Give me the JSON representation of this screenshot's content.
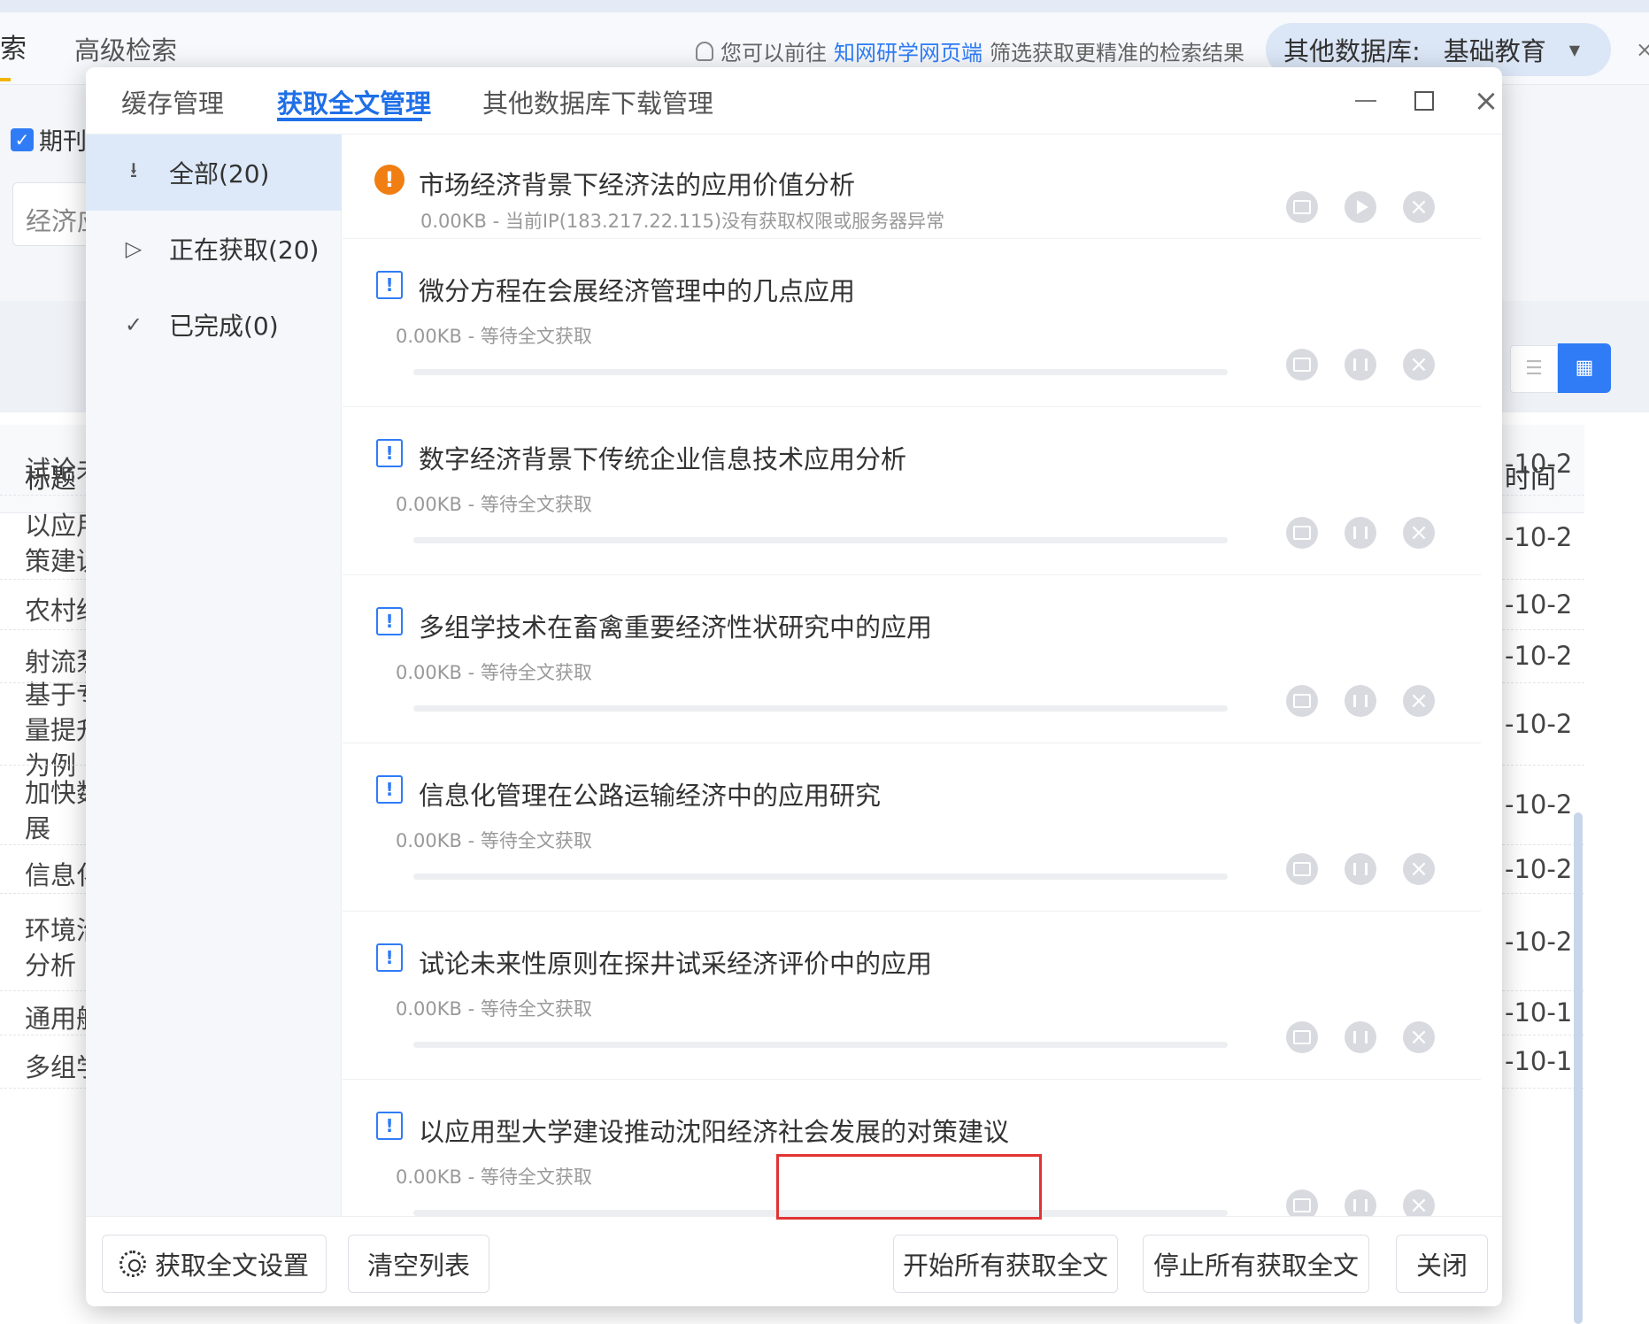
{
  "background": {
    "tab_cut": "索",
    "tab_advanced": "高级检索",
    "notice_prefix": "您可以前往",
    "notice_link": "知网研学网页端",
    "notice_suffix": "筛选获取更精准的检索结果",
    "db_label": "其他数据库:",
    "db_value": "基础教育",
    "close_glyph": "×",
    "filter_checkbox": "期刊",
    "search_value": "经济应",
    "table_header_title": "标题",
    "table_header_time": "时间",
    "rows": [
      {
        "title": "试论未",
        "date": "-10-2"
      },
      {
        "title": "以应用型\n策建议",
        "date": "-10-2"
      },
      {
        "title": "农村经",
        "date": "-10-2"
      },
      {
        "title": "射流泵",
        "date": "-10-2"
      },
      {
        "title": "基于专\n量提升\n为例",
        "date": "-10-2"
      },
      {
        "title": "加快数\n展",
        "date": "-10-2"
      },
      {
        "title": "信息化",
        "date": "-10-2"
      },
      {
        "title": "环境治\n分析",
        "date": "-10-2"
      },
      {
        "title": "通用航",
        "date": "-10-1"
      },
      {
        "title": "多组学",
        "date": "-10-1"
      }
    ]
  },
  "dialog": {
    "tabs": [
      "缓存管理",
      "获取全文管理",
      "其他数据库下载管理"
    ],
    "active_tab": "获取全文管理",
    "sidebar": [
      {
        "label": "全部(20)",
        "icon": "download-arrow-icon",
        "glyph": "⭳"
      },
      {
        "label": "正在获取(20)",
        "icon": "play-outline-icon",
        "glyph": "▷"
      },
      {
        "label": "已完成(0)",
        "icon": "check-icon",
        "glyph": "✓"
      }
    ],
    "items": [
      {
        "title": "市场经济背景下经济法的应用价值分析",
        "status": "0.00KB - 当前IP(183.217.22.115)没有获取权限或服务器异常",
        "state": "error"
      },
      {
        "title": "微分方程在会展经济管理中的几点应用",
        "status": "0.00KB - 等待全文获取",
        "state": "waiting",
        "progress": 0
      },
      {
        "title": "数字经济背景下传统企业信息技术应用分析",
        "status": "0.00KB - 等待全文获取",
        "state": "waiting",
        "progress": 0
      },
      {
        "title": "多组学技术在畜禽重要经济性状研究中的应用",
        "status": "0.00KB - 等待全文获取",
        "state": "waiting",
        "progress": 0
      },
      {
        "title": "信息化管理在公路运输经济中的应用研究",
        "status": "0.00KB - 等待全文获取",
        "state": "waiting",
        "progress": 0
      },
      {
        "title": "试论未来性原则在探井试采经济评价中的应用",
        "status": "0.00KB - 等待全文获取",
        "state": "waiting",
        "progress": 0
      },
      {
        "title": "以应用型大学建设推动沈阳经济社会发展的对策建议",
        "status": "0.00KB - 等待全文获取",
        "state": "waiting",
        "progress": 0
      }
    ],
    "footer": {
      "settings": "获取全文设置",
      "clear": "清空列表",
      "start_all": "开始所有获取全文",
      "stop_all": "停止所有获取全文",
      "close": "关闭"
    }
  },
  "colors": {
    "accent": "#1f6fe8",
    "error": "#f07e12",
    "highlight": "#e23333"
  }
}
